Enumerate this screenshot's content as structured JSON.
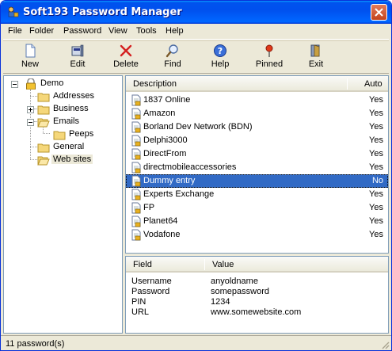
{
  "window": {
    "title": "Soft193 Password Manager"
  },
  "menu": [
    "File",
    "Folder",
    "Password",
    "View",
    "Tools",
    "Help"
  ],
  "toolbar": [
    {
      "label": "New",
      "icon": "new-document-icon"
    },
    {
      "label": "Edit",
      "icon": "edit-icon"
    },
    {
      "label": "Delete",
      "icon": "delete-icon"
    },
    {
      "label": "Find",
      "icon": "find-icon"
    },
    {
      "label": "Help",
      "icon": "help-icon"
    },
    {
      "label": "Pinned",
      "icon": "pin-icon"
    },
    {
      "label": "Exit",
      "icon": "exit-icon"
    }
  ],
  "tree": {
    "root": "Demo",
    "items": [
      {
        "label": "Addresses"
      },
      {
        "label": "Business"
      },
      {
        "label": "Emails"
      },
      {
        "label": "Peeps"
      },
      {
        "label": "General"
      },
      {
        "label": "Web sites"
      }
    ]
  },
  "list": {
    "columns": [
      "Description",
      "Auto"
    ],
    "rows": [
      {
        "description": "1837 Online",
        "auto": "Yes"
      },
      {
        "description": "Amazon",
        "auto": "Yes"
      },
      {
        "description": "Borland Dev Network (BDN)",
        "auto": "Yes"
      },
      {
        "description": "Delphi3000",
        "auto": "Yes"
      },
      {
        "description": "DirectFrom",
        "auto": "Yes"
      },
      {
        "description": "directmobileaccessories",
        "auto": "Yes"
      },
      {
        "description": "Dummy entry",
        "auto": "No"
      },
      {
        "description": "Experts Exchange",
        "auto": "Yes"
      },
      {
        "description": "FP",
        "auto": "Yes"
      },
      {
        "description": "Planet64",
        "auto": "Yes"
      },
      {
        "description": "Vodafone",
        "auto": "Yes"
      }
    ],
    "selected_index": 6
  },
  "details": {
    "columns": [
      "Field",
      "Value"
    ],
    "rows": [
      {
        "field": "Username",
        "value": "anyoldname"
      },
      {
        "field": "Password",
        "value": "somepassword"
      },
      {
        "field": "PIN",
        "value": "1234"
      },
      {
        "field": "URL",
        "value": "www.somewebsite.com"
      }
    ]
  },
  "status": {
    "text": "11 password(s)"
  },
  "colors": {
    "title_bar": "#0053ee",
    "selection": "#316ac5",
    "folder": "#f5d77a"
  }
}
